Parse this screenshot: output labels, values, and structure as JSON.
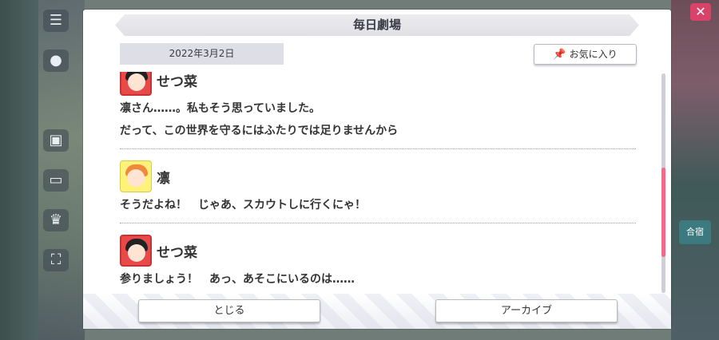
{
  "dialog": {
    "title": "毎日劇場",
    "date": "2022年3月2日",
    "favorite_label": "お気に入り",
    "entries": [
      {
        "speaker": "せつ菜",
        "avatar": "setsuna-avatar",
        "lines": [
          "凛さん……。私もそう思っていました。",
          "だって、この世界を守るにはふたりでは足りませんから"
        ]
      },
      {
        "speaker": "凛",
        "avatar": "rin-avatar",
        "lines": [
          "そうだよね！　じゃあ、スカウトしに行くにゃ！"
        ]
      },
      {
        "speaker": "せつ菜",
        "avatar": "setsuna-avatar",
        "lines": [
          "参りましょう！　あっ、あそこにいるのは……"
        ]
      }
    ],
    "close_label": "とじる",
    "archive_label": "アーカイブ"
  },
  "background": {
    "right_badge": "合宿"
  },
  "colors": {
    "scroll_thumb": "#f06a8a",
    "setsuna_frame": "#e84a4a",
    "rin_frame": "#fff27a"
  },
  "icons": [
    "menu-icon",
    "chat-icon",
    "gift-icon",
    "monitor-icon",
    "crown-icon",
    "fullscreen-icon",
    "pin-icon",
    "close-corner-icon"
  ]
}
